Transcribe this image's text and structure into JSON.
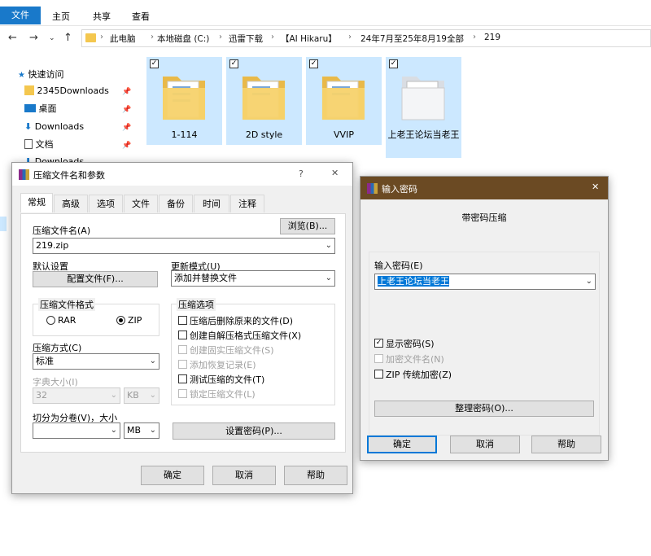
{
  "explorer": {
    "ribbon_tabs": [
      "文件",
      "主页",
      "共享",
      "查看"
    ],
    "breadcrumb": [
      "此电脑",
      "本地磁盘 (C:)",
      "迅雷下载",
      "【AI Hikaru】",
      "24年7月至25年8月19全部",
      "219"
    ],
    "nav_items": [
      {
        "label": "快速访问",
        "icon": "star-icon"
      },
      {
        "label": "2345Downloads",
        "icon": "folder-icon"
      },
      {
        "label": "桌面",
        "icon": "desktop-icon"
      },
      {
        "label": "Downloads",
        "icon": "download-arrow-icon"
      },
      {
        "label": "文档",
        "icon": "document-icon"
      },
      {
        "label": "Downloads",
        "icon": "download-arrow-icon"
      }
    ],
    "folders": [
      {
        "label": "1-114",
        "checked": true
      },
      {
        "label": "2D style",
        "checked": true
      },
      {
        "label": "VVIP",
        "checked": true
      },
      {
        "label": "上老王论坛当老王",
        "checked": true
      }
    ],
    "accent_color": "#1979ca",
    "selection_color": "#cce8ff"
  },
  "archive_dialog": {
    "title": "压缩文件名和参数",
    "help_glyph": "?",
    "close_glyph": "✕",
    "tabs": [
      "常规",
      "高级",
      "选项",
      "文件",
      "备份",
      "时间",
      "注释"
    ],
    "archive_name_label": "压缩文件名(A)",
    "browse_button": "浏览(B)...",
    "archive_name_value": "219.zip",
    "default_settings_label": "默认设置",
    "profiles_button": "配置文件(F)...",
    "update_mode_label": "更新模式(U)",
    "update_mode_value": "添加并替换文件",
    "format_group": "压缩文件格式",
    "format_rar": "RAR",
    "format_zip": "ZIP",
    "options_group": "压缩选项",
    "options": [
      {
        "label": "压缩后删除原来的文件(D)",
        "checked": false,
        "enabled": true
      },
      {
        "label": "创建自解压格式压缩文件(X)",
        "checked": false,
        "enabled": true
      },
      {
        "label": "创建固实压缩文件(S)",
        "checked": false,
        "enabled": false
      },
      {
        "label": "添加恢复记录(E)",
        "checked": false,
        "enabled": false
      },
      {
        "label": "测试压缩的文件(T)",
        "checked": false,
        "enabled": true
      },
      {
        "label": "锁定压缩文件(L)",
        "checked": false,
        "enabled": false
      }
    ],
    "method_label": "压缩方式(C)",
    "method_value": "标准",
    "dict_label": "字典大小(I)",
    "dict_value": "32",
    "dict_unit": "KB",
    "split_label": "切分为分卷(V)，大小",
    "split_value": "",
    "split_unit": "MB",
    "set_password_button": "设置密码(P)...",
    "ok_button": "确定",
    "cancel_button": "取消",
    "help_button": "帮助"
  },
  "password_dialog": {
    "title": "输入密码",
    "close_glyph": "✕",
    "header": "带密码压缩",
    "password_label": "输入密码(E)",
    "password_value": "上老王论坛当老王",
    "show_password": "显示密码(S)",
    "encrypt_names": "加密文件名(N)",
    "zip_legacy": "ZIP 传统加密(Z)",
    "organize_button": "整理密码(O)...",
    "ok_button": "确定",
    "cancel_button": "取消",
    "help_button": "帮助",
    "title_bar_color": "#6b4a23"
  }
}
